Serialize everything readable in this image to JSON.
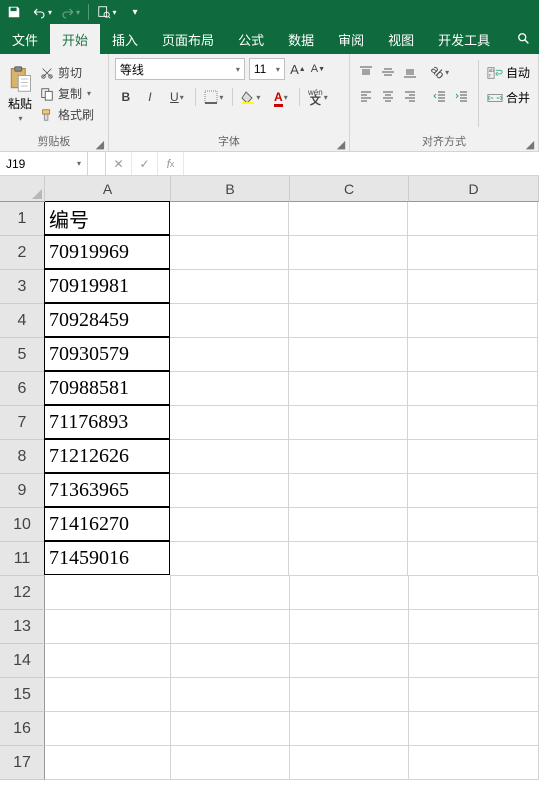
{
  "titlebar": {
    "save": "save",
    "undo": "undo",
    "redo": "redo",
    "preview": "preview"
  },
  "tabs": {
    "file": "文件",
    "home": "开始",
    "insert": "插入",
    "layout": "页面布局",
    "formulas": "公式",
    "data": "数据",
    "review": "审阅",
    "view": "视图",
    "dev": "开发工具"
  },
  "ribbon": {
    "clipboard": {
      "paste": "粘贴",
      "cut": "剪切",
      "copy": "复制",
      "format_painter": "格式刷",
      "group_label": "剪贴板"
    },
    "font": {
      "name": "等线",
      "size": "11",
      "group_label": "字体",
      "wen": "wén"
    },
    "alignment": {
      "group_label": "对齐方式",
      "wrap": "自动",
      "merge": "合并"
    }
  },
  "namebox": "J19",
  "columns": {
    "widths": [
      126,
      119,
      119,
      130
    ],
    "labels": [
      "A",
      "B",
      "C",
      "D"
    ]
  },
  "rows": {
    "labels": [
      "1",
      "2",
      "3",
      "4",
      "5",
      "6",
      "7",
      "8",
      "9",
      "10",
      "11",
      "12",
      "13",
      "14",
      "15",
      "16",
      "17"
    ]
  },
  "cells_A": [
    "编号",
    "70919969",
    "70919981",
    "70928459",
    "70930579",
    "70988581",
    "71176893",
    "71212626",
    "71363965",
    "71416270",
    "71459016"
  ]
}
